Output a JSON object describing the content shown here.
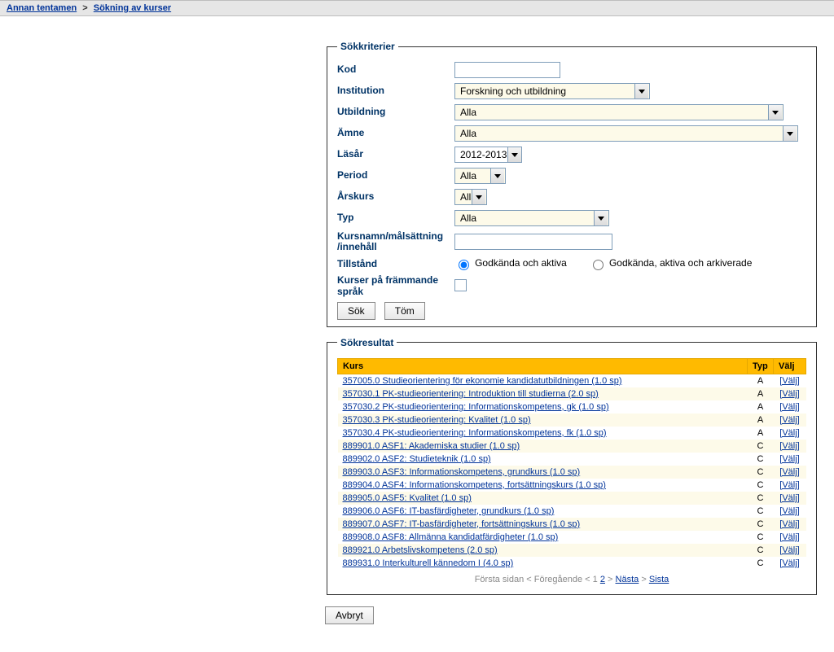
{
  "breadcrumb": {
    "item1": "Annan tentamen",
    "sep": ">",
    "item2": "Sökning av kurser"
  },
  "criteria": {
    "legend": "Sökkriterier",
    "kod_label": "Kod",
    "kod_value": "",
    "institution_label": "Institution",
    "institution_value": "Forskning och utbildning",
    "utbildning_label": "Utbildning",
    "utbildning_value": "Alla",
    "amne_label": "Ämne",
    "amne_value": "Alla",
    "lasar_label": "Läsår",
    "lasar_value": "2012-2013",
    "period_label": "Period",
    "period_value": "Alla",
    "arskurs_label": "Årskurs",
    "arskurs_value": "Alla",
    "typ_label": "Typ",
    "typ_value": "Alla",
    "kursnamn_label": "Kursnamn/målsättning\n/innehåll",
    "kursnamn_value": "",
    "tillstand_label": "Tillstånd",
    "tillstand_opt1": "Godkända och aktiva",
    "tillstand_opt2": "Godkända, aktiva och arkiverade",
    "frammande_label": "Kurser på främmande språk",
    "search_btn": "Sök",
    "clear_btn": "Töm"
  },
  "results": {
    "legend": "Sökresultat",
    "col_kurs": "Kurs",
    "col_typ": "Typ",
    "col_valj": "Välj",
    "pick_label": "[Välj]",
    "rows": [
      {
        "name": "357005.0 Studieorientering för ekonomie kandidatutbildningen (1.0 sp)",
        "typ": "A"
      },
      {
        "name": "357030.1 PK-studieorientering: Introduktion till studierna (2.0 sp)",
        "typ": "A"
      },
      {
        "name": "357030.2 PK-studieorientering: Informationskompetens, gk (1.0 sp)",
        "typ": "A"
      },
      {
        "name": "357030.3 PK-studieorientering: Kvalitet (1.0 sp)",
        "typ": "A"
      },
      {
        "name": "357030.4 PK-studieorientering: Informationskompetens, fk (1.0 sp)",
        "typ": "A"
      },
      {
        "name": "889901.0 ASF1: Akademiska studier (1.0 sp)",
        "typ": "C"
      },
      {
        "name": "889902.0 ASF2: Studieteknik (1.0 sp)",
        "typ": "C"
      },
      {
        "name": "889903.0 ASF3: Informationskompetens, grundkurs (1.0 sp)",
        "typ": "C"
      },
      {
        "name": "889904.0 ASF4: Informationskompetens, fortsättningskurs (1.0 sp)",
        "typ": "C"
      },
      {
        "name": "889905.0 ASF5: Kvalitet (1.0 sp)",
        "typ": "C"
      },
      {
        "name": "889906.0 ASF6: IT-basfärdigheter, grundkurs (1.0 sp)",
        "typ": "C"
      },
      {
        "name": "889907.0 ASF7: IT-basfärdigheter, fortsättningskurs (1.0 sp)",
        "typ": "C"
      },
      {
        "name": "889908.0 ASF8: Allmänna kandidatfärdigheter (1.0 sp)",
        "typ": "C"
      },
      {
        "name": "889921.0 Arbetslivskompetens (2.0 sp)",
        "typ": "C"
      },
      {
        "name": "889931.0 Interkulturell kännedom I (4.0 sp)",
        "typ": "C"
      }
    ],
    "pager": {
      "first": "Första sidan",
      "prev": "Föregående",
      "p1": "1",
      "p2": "2",
      "next": "Nästa",
      "last": "Sista"
    }
  },
  "cancel_btn": "Avbryt"
}
